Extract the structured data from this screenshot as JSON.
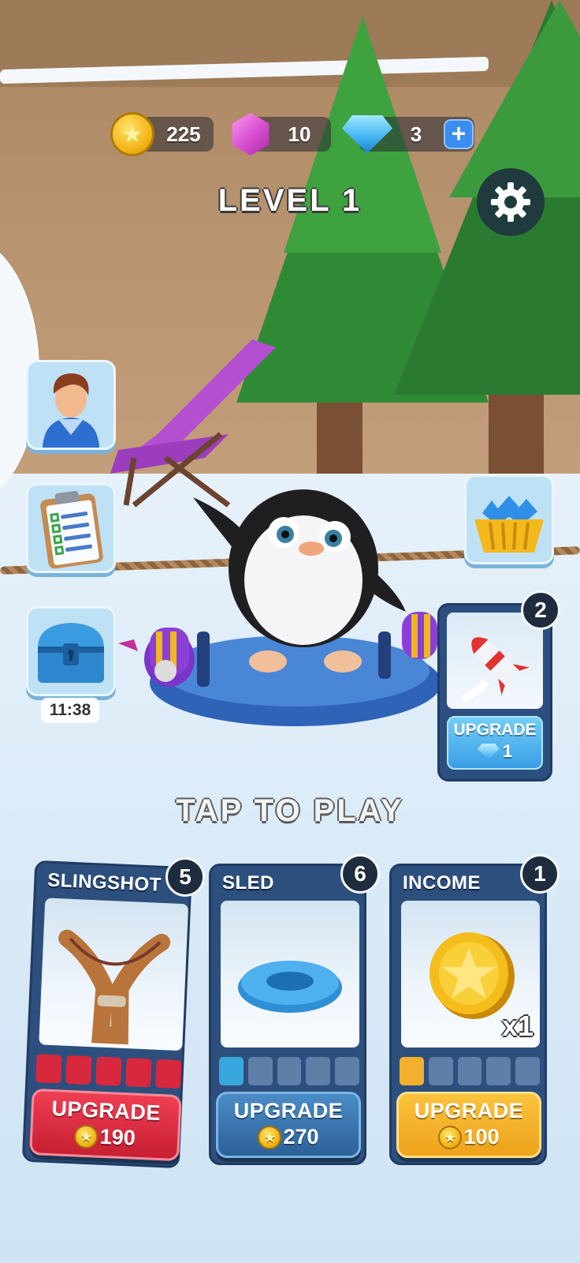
{
  "currency": {
    "coins": "225",
    "gems": "10",
    "diamonds": "3",
    "plus_label": "+"
  },
  "header": {
    "level_title": "LEVEL 1"
  },
  "side_menu": {
    "chest_timer": "11:38"
  },
  "rocket_card": {
    "badge": "2",
    "upgrade_label": "UPGRADE",
    "upgrade_cost": "1"
  },
  "prompt": {
    "tap_to_play": "TAP TO PLAY"
  },
  "upgrade_cards": [
    {
      "title": "SLINGSHOT",
      "level": "5",
      "upgrade_label": "UPGRADE",
      "cost": "190",
      "filled_pips": 5,
      "pip_total": 5,
      "color": "#d42a3e"
    },
    {
      "title": "SLED",
      "level": "6",
      "upgrade_label": "UPGRADE",
      "cost": "270",
      "filled_pips": 1,
      "pip_total": 5,
      "color": "#3b73a6"
    },
    {
      "title": "INCOME",
      "level": "1",
      "upgrade_label": "UPGRADE",
      "cost": "100",
      "multiplier": "x1",
      "filled_pips": 1,
      "pip_total": 5,
      "color": "#f3b02c"
    }
  ],
  "icons": {
    "coin": "coin-icon",
    "gem": "gem-icon",
    "diamond": "diamond-icon",
    "settings": "gear-icon",
    "profile": "avatar-icon",
    "tasks": "clipboard-icon",
    "chest": "chest-icon",
    "gem_shop": "gem-basket-icon",
    "rocket": "rocket-icon"
  }
}
